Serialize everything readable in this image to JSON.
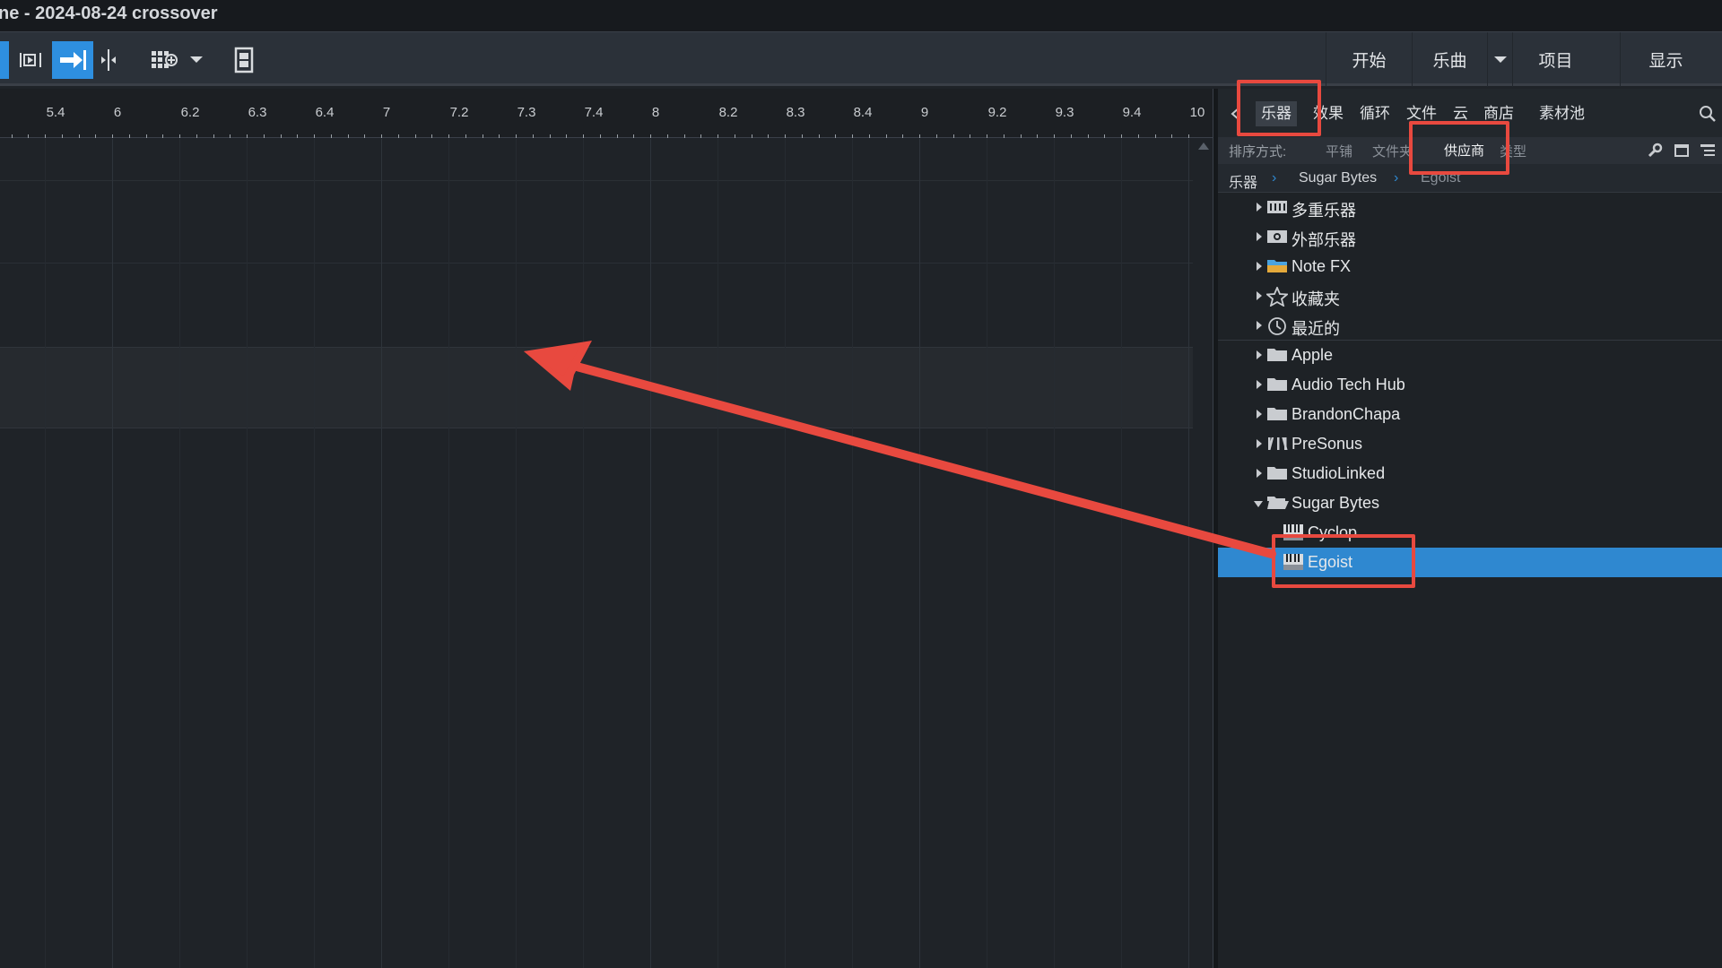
{
  "window": {
    "title": "ne - 2024-08-24 crossover"
  },
  "toolbar": {
    "right_buttons": [
      "开始",
      "乐曲",
      "项目",
      "显示"
    ]
  },
  "ruler": {
    "labels": [
      "5.4",
      "6",
      "6.2",
      "6.3",
      "6.4",
      "7",
      "7.2",
      "7.3",
      "7.4",
      "8",
      "8.2",
      "8.3",
      "8.4",
      "9",
      "9.2",
      "9.3",
      "9.4",
      "10"
    ]
  },
  "browser": {
    "tabs": [
      "乐器",
      "效果",
      "循环",
      "文件",
      "云",
      "商店",
      "素材池"
    ],
    "active_tab": "乐器",
    "sort_label": "排序方式:",
    "sort_options": [
      "平铺",
      "文件夹",
      "供应商",
      "类型"
    ],
    "active_sort": "供应商",
    "breadcrumb": [
      "乐器",
      "Sugar Bytes",
      "Egoist"
    ],
    "tree": [
      {
        "label": "多重乐器",
        "icon": "multi-instrument-icon",
        "expanded": false
      },
      {
        "label": "外部乐器",
        "icon": "external-instrument-icon",
        "expanded": false
      },
      {
        "label": "Note FX",
        "icon": "note-fx-folder-icon",
        "expanded": false
      },
      {
        "label": "收藏夹",
        "icon": "star-icon",
        "expanded": false
      },
      {
        "label": "最近的",
        "icon": "clock-icon",
        "expanded": false
      },
      {
        "label": "Apple",
        "icon": "folder-icon",
        "expanded": false
      },
      {
        "label": "Audio Tech Hub",
        "icon": "folder-icon",
        "expanded": false
      },
      {
        "label": "BrandonChapa",
        "icon": "folder-icon",
        "expanded": false
      },
      {
        "label": "PreSonus",
        "icon": "presonus-logo-icon",
        "expanded": false
      },
      {
        "label": "StudioLinked",
        "icon": "folder-icon",
        "expanded": false
      },
      {
        "label": "Sugar Bytes",
        "icon": "open-folder-icon",
        "expanded": true
      },
      {
        "label": "Cyclop",
        "icon": "keyboard-plugin-icon",
        "child": true
      },
      {
        "label": "Egoist",
        "icon": "keyboard-plugin-icon",
        "child": true,
        "selected": true
      }
    ]
  },
  "colors": {
    "accent": "#2f88d0",
    "annotation": "#e8493f",
    "background": "#1f2328"
  }
}
